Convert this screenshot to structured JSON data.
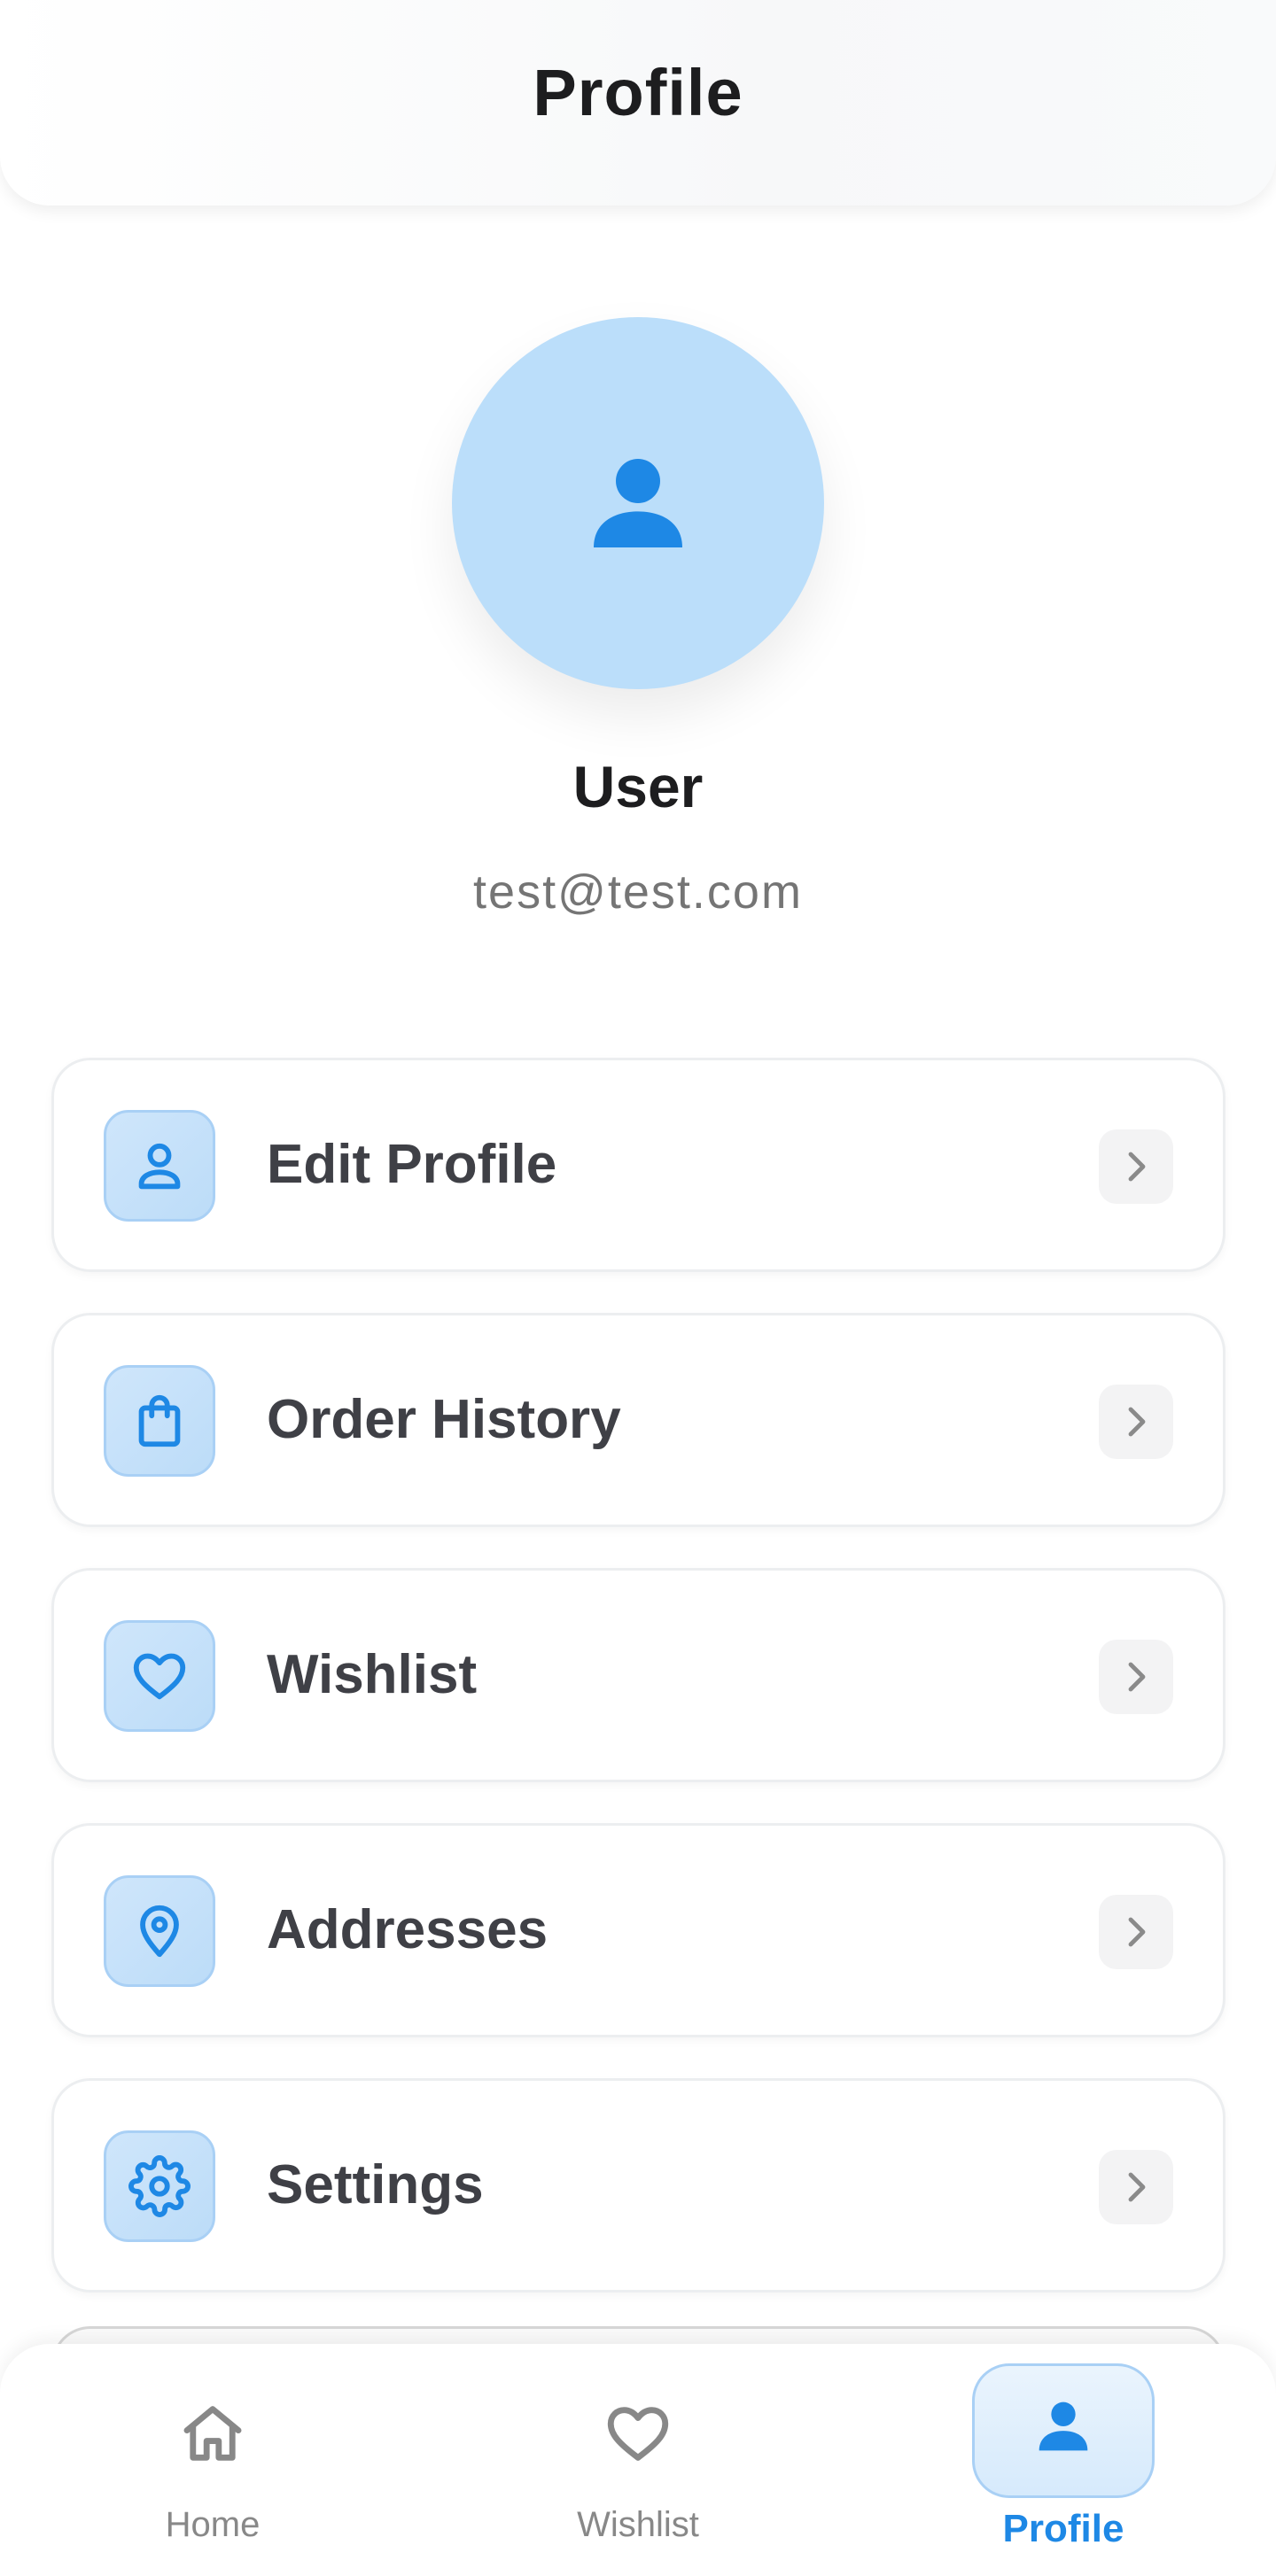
{
  "header": {
    "title": "Profile"
  },
  "profile": {
    "name": "User",
    "email": "test@test.com"
  },
  "menu": {
    "items": [
      {
        "label": "Edit Profile",
        "icon": "person-outline-icon"
      },
      {
        "label": "Order History",
        "icon": "shopping-bag-icon"
      },
      {
        "label": "Wishlist",
        "icon": "heart-outline-icon"
      },
      {
        "label": "Addresses",
        "icon": "location-pin-icon"
      },
      {
        "label": "Settings",
        "icon": "gear-icon"
      }
    ]
  },
  "bottom_nav": {
    "items": [
      {
        "label": "Home",
        "icon": "home-icon",
        "active": false
      },
      {
        "label": "Wishlist",
        "icon": "heart-outline-icon",
        "active": false
      },
      {
        "label": "Profile",
        "icon": "person-icon",
        "active": true
      }
    ]
  },
  "colors": {
    "accent": "#1e88e5",
    "avatar_bg": "#bbdefa",
    "icon_tile_bg": "#cfe6fb",
    "text_primary": "#1d1d1f",
    "text_menu": "#3f4046",
    "text_muted": "#757575"
  }
}
